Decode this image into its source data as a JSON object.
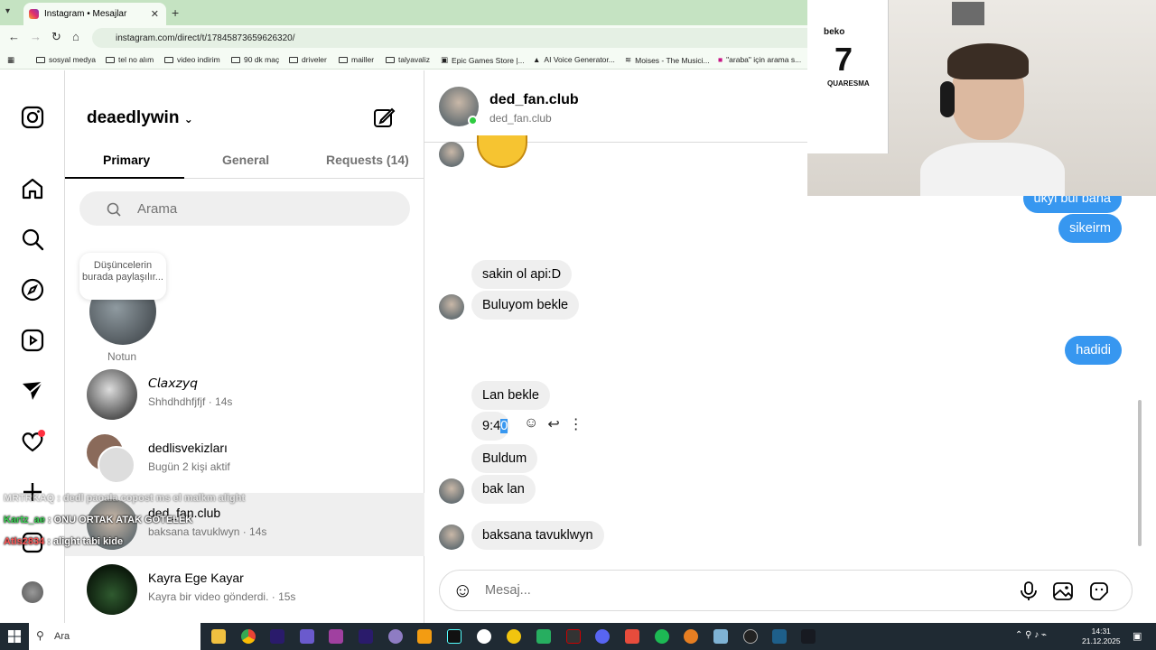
{
  "browser": {
    "tab_title": "Instagram • Mesajlar",
    "url": "instagram.com/direct/t/17845873659626320/",
    "bookmarks": [
      "sosyal medya",
      "tel no alım",
      "video indirim",
      "90 dk maç",
      "driveler",
      "mailler",
      "talyavaliz",
      "Epic Games Store |...",
      "AI Voice Generator...",
      "Moises - The Musici...",
      "\"araba\" için arama s..."
    ]
  },
  "sidebar": {
    "username": "deaedlywin",
    "tabs": [
      "Primary",
      "General",
      "Requests (14)"
    ],
    "search_placeholder": "Arama",
    "note_text": "Düşüncelerin burada paylaşılır...",
    "note_label": "Notun",
    "conversations": [
      {
        "name": "𝘊𝘭𝘢𝘹𝘻𝘺𝘲",
        "sub": "Shhdhdhfjfjf · 14s"
      },
      {
        "name": "dedlisvekizları",
        "sub": "Bugün 2 kişi aktif"
      },
      {
        "name": "ded_fan.club",
        "sub": "baksana tavuklwyn · 14s"
      },
      {
        "name": "Kayra Ege Kayar",
        "sub": "Kayra bir video gönderdi. · 15s"
      }
    ]
  },
  "chat": {
    "name": "ded_fan.club",
    "handle": "ded_fan.club",
    "outgoing": [
      "ukyi bul bana",
      "sikeirm",
      "hadidi"
    ],
    "incoming": [
      "sakin ol api:D",
      "Buluyom bekle",
      "Lan bekle",
      "Buldum",
      "bak lan",
      "baksana tavuklwyn"
    ],
    "time_label": "9:4",
    "time_selected": "0",
    "composer_placeholder": "Mesaj..."
  },
  "stream_overlay": [
    {
      "user": "MRTRKAQ",
      "text": ": dedl paoala copost ms el malkm alight"
    },
    {
      "user": "Kartz_ae",
      "text": ": ONU ORTAK ATAK GOTELEK"
    },
    {
      "user": "Atls2834",
      "text": ": alight tabi kide"
    }
  ],
  "webcam": {
    "jersey_sponsor": "beko",
    "jersey_number": "7",
    "jersey_name": "QUARESMA"
  },
  "taskbar": {
    "search_label": "Ara",
    "time": "14:31",
    "date": "21.12.2025"
  },
  "colors": {
    "accent": "#3797f0",
    "online": "#2ecc40",
    "notify": "#ff3040"
  }
}
